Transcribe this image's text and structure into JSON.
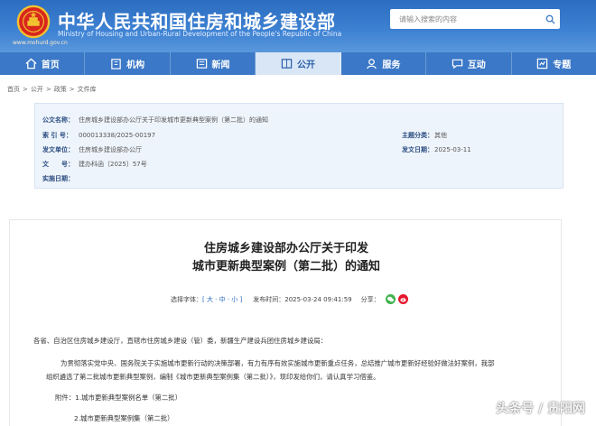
{
  "header": {
    "site_name_cn": "中华人民共和国住房和城乡建设部",
    "site_name_en": "Ministry of Housing and Urban-Rural Development of the People's Republic of China",
    "site_url": "www.mohurd.gov.cn",
    "search_placeholder": "请输入搜索的内容"
  },
  "nav": [
    {
      "label": "首页",
      "icon": "home-icon"
    },
    {
      "label": "机构",
      "icon": "building-icon"
    },
    {
      "label": "新闻",
      "icon": "news-icon"
    },
    {
      "label": "公开",
      "icon": "public-icon"
    },
    {
      "label": "服务",
      "icon": "service-icon"
    },
    {
      "label": "互动",
      "icon": "interact-icon"
    },
    {
      "label": "专题",
      "icon": "topic-icon"
    }
  ],
  "breadcrumb": [
    "首页",
    "公开",
    "政策",
    "文件库"
  ],
  "meta": {
    "title_label": "公文名称：",
    "title_value": "住房城乡建设部办公厅关于印发城市更新典型案例（第二批）的通知",
    "index_label": "索 引 号：",
    "index_value": "000013338/2025-00197",
    "category_label": "主题分类：",
    "category_value": "其他",
    "issuer_label": "发文单位：",
    "issuer_value": "住房城乡建设部办公厅",
    "date_label": "发文日期：",
    "date_value": "2025-03-11",
    "doc_label": "文　　号：",
    "doc_value": "建办科函〔2025〕57号",
    "implement_label": "实施日期：",
    "implement_value": ""
  },
  "article": {
    "title_line1": "住房城乡建设部办公厅关于印发",
    "title_line2": "城市更新典型案例（第二批）的通知",
    "font_size_label": "选择字体：",
    "font_size_options": "[ 大 · 中 · 小 ]",
    "publish_label": "发布时间：",
    "publish_time": "2025-03-24 09:41:59",
    "share_label": "分享：",
    "salutation": "各省、自治区住房城乡建设厅，直辖市住房城乡建设（管）委，新疆生产建设兵团住房城乡建设局：",
    "body_line1": "为贯彻落实党中央、国务院关于实施城市更新行动的决策部署，有力有序有效实施城市更新重点任务，总结推广城市更新好经验好做法好案例，我部",
    "body_line2": "组织遴选了第二批城市更新典型案例，编制《城市更新典型案例集（第二批）》，现印发给你们，请认真学习借鉴。",
    "attachment1": "附件：1.城市更新典型案例名单（第二批）",
    "attachment2": "2.城市更新典型案例集（第二批）"
  },
  "watermark": "头条号 / 贵阳网",
  "colors": {
    "header_blue": "#2c6dc0",
    "nav_blue": "#3b78c7",
    "nav_active_bg": "#d9e6f6",
    "meta_bg": "#eef4fb",
    "emblem_red": "#d8261d"
  }
}
